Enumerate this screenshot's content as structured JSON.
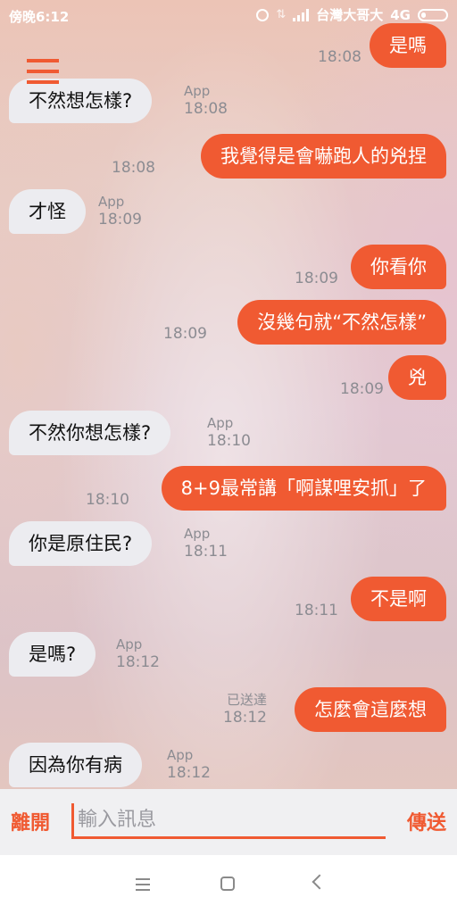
{
  "status_bar": {
    "time": "傍晚6:12",
    "carrier": "台灣大哥大",
    "network": "4G"
  },
  "messages": [
    {
      "dir": "out",
      "text": "是嗎",
      "time": "18:08"
    },
    {
      "dir": "in",
      "text": "不然想怎樣?",
      "sender": "App",
      "time": "18:08"
    },
    {
      "dir": "out",
      "text": "我覺得是會嚇跑人的兇捏",
      "time": "18:08"
    },
    {
      "dir": "in",
      "text": "才怪",
      "sender": "App",
      "time": "18:09"
    },
    {
      "dir": "out",
      "text": "你看你",
      "time": "18:09"
    },
    {
      "dir": "out",
      "text": "沒幾句就“不然怎樣”",
      "time": "18:09"
    },
    {
      "dir": "out",
      "text": "兇",
      "time": "18:09"
    },
    {
      "dir": "in",
      "text": "不然你想怎樣?",
      "sender": "App",
      "time": "18:10"
    },
    {
      "dir": "out",
      "text": "8+9最常講「啊謀哩安抓」了",
      "time": "18:10"
    },
    {
      "dir": "in",
      "text": "你是原住民?",
      "sender": "App",
      "time": "18:11"
    },
    {
      "dir": "out",
      "text": "不是啊",
      "time": "18:11"
    },
    {
      "dir": "in",
      "text": "是嗎?",
      "sender": "App",
      "time": "18:12"
    },
    {
      "dir": "out",
      "text": "怎麼會這麼想",
      "time": "18:12",
      "status": "已送達"
    },
    {
      "dir": "in",
      "text": "因為你有病",
      "sender": "App",
      "time": "18:12"
    }
  ],
  "input_bar": {
    "leave_label": "離開",
    "placeholder": "輸入訊息",
    "send_label": "傳送"
  },
  "colors": {
    "accent": "#f05a32",
    "incoming_bubble": "#ececf0",
    "meta_text": "#8c8c92"
  }
}
